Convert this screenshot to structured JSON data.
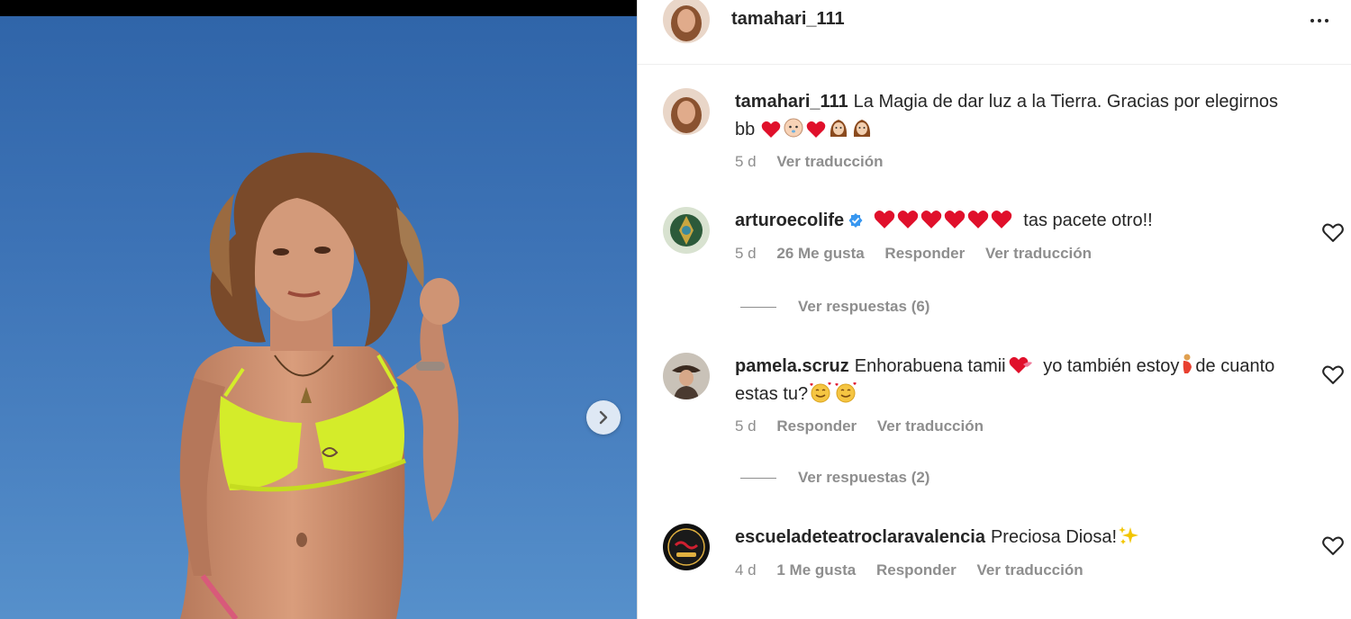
{
  "post": {
    "author": "tamahari_111"
  },
  "caption": {
    "username": "tamahari_111",
    "text": "La Magia de dar luz a la Tierra. Gracias por elegirnos bb",
    "time": "5 d",
    "translate": "Ver traducción"
  },
  "comments": [
    {
      "username": "arturoecolife",
      "text": "tas pacete otro!!",
      "time": "5 d",
      "likes": "26 Me gusta",
      "reply": "Responder",
      "translate": "Ver traducción",
      "view_replies": "Ver respuestas (6)"
    },
    {
      "username": "pamela.scruz",
      "text_a": "Enhorabuena tamii",
      "text_b": "yo también estoy",
      "text_c": "de cuanto estas tu?",
      "time": "5 d",
      "reply": "Responder",
      "translate": "Ver traducción",
      "view_replies": "Ver respuestas (2)"
    },
    {
      "username": "escueladeteatroclaravalencia",
      "text": "Preciosa Diosa!",
      "time": "4 d",
      "likes": "1 Me gusta",
      "reply": "Responder",
      "translate": "Ver traducción"
    }
  ],
  "icons": {
    "next": "chevron-right-icon",
    "more": "more-options-icon",
    "like": "heart-outline-icon",
    "verified": "verified-badge-icon"
  },
  "colors": {
    "sky": "#3d73b6",
    "bikini": "#d4ec2a",
    "verified": "#3897f0",
    "heart_emoji": "#e0102b",
    "muted_text": "#8e8e8e"
  }
}
